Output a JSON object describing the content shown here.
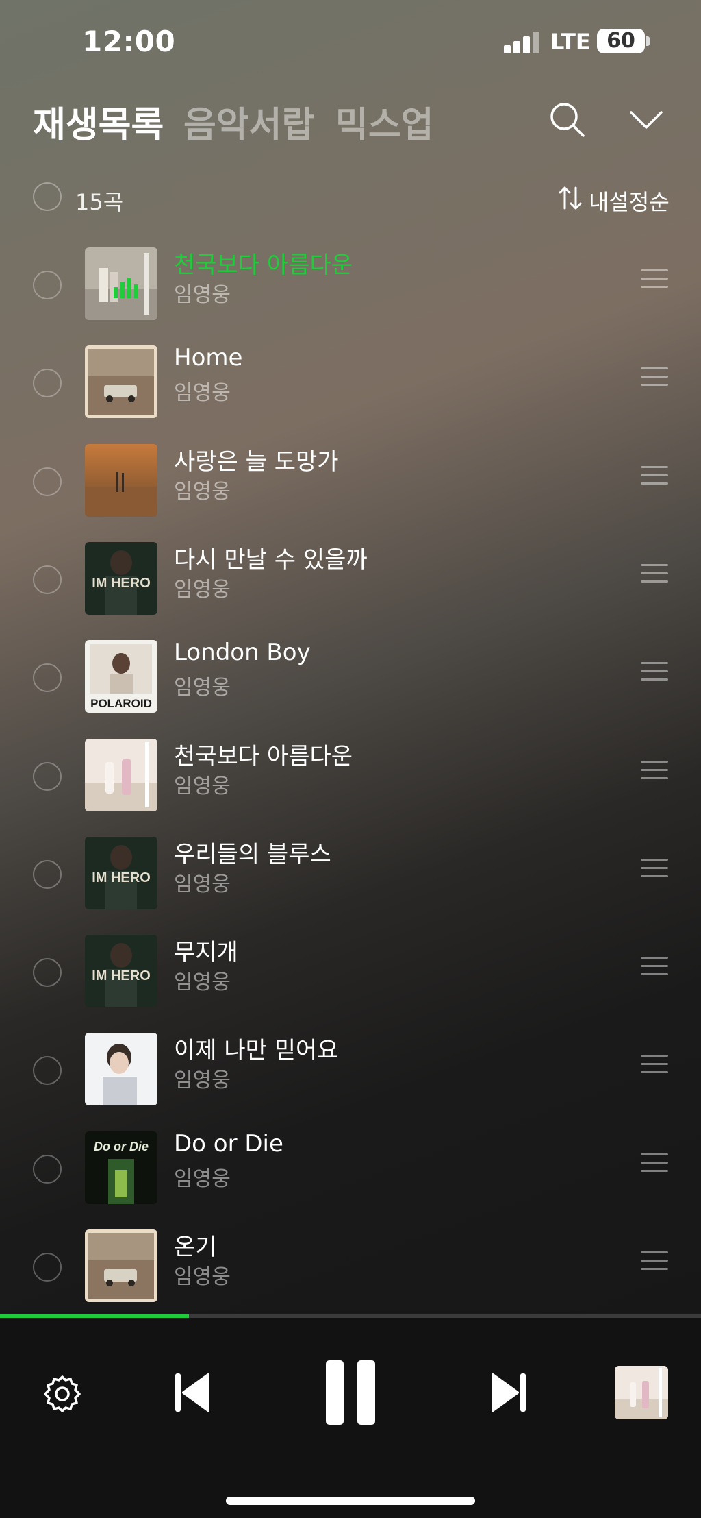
{
  "status_bar": {
    "time": "12:00",
    "network": "LTE",
    "battery": "60",
    "icons": [
      "signal-icon",
      "battery-icon"
    ]
  },
  "tabs": [
    {
      "label": "재생목록",
      "active": true
    },
    {
      "label": "음악서랍",
      "active": false
    },
    {
      "label": "믹스업",
      "active": false
    }
  ],
  "header_icons": [
    "search-icon",
    "chevron-down-icon"
  ],
  "list_header": {
    "count": "15곡",
    "sort_label": "내설정순",
    "sort_icon": "sort-arrows-icon"
  },
  "tracks": [
    {
      "title": "천국보다 아름다운",
      "artist": "임영웅",
      "playing": true
    },
    {
      "title": "Home",
      "artist": "임영웅",
      "playing": false
    },
    {
      "title": "사랑은 늘 도망가",
      "artist": "임영웅",
      "playing": false
    },
    {
      "title": "다시 만날 수 있을까",
      "artist": "임영웅",
      "playing": false
    },
    {
      "title": "London Boy",
      "artist": "임영웅",
      "playing": false
    },
    {
      "title": "천국보다 아름다운",
      "artist": "임영웅",
      "playing": false
    },
    {
      "title": "우리들의 블루스",
      "artist": "임영웅",
      "playing": false
    },
    {
      "title": "무지개",
      "artist": "임영웅",
      "playing": false
    },
    {
      "title": "이제 나만 믿어요",
      "artist": "임영웅",
      "playing": false
    },
    {
      "title": "Do or Die",
      "artist": "임영웅",
      "playing": false
    },
    {
      "title": "온기",
      "artist": "임영웅",
      "playing": false
    }
  ],
  "album_art_text": {
    "im_hero": "IM HERO",
    "polaroid": "POLAROID",
    "do_or_die": "Do or Die"
  },
  "playback": {
    "progress_fraction": 0.27
  },
  "player_controls": [
    "settings-gear-icon",
    "previous-track-icon",
    "pause-icon",
    "next-track-icon",
    "now-playing-thumbnail"
  ],
  "colors": {
    "accent": "#1fcc3a",
    "background_dark": "#121212"
  }
}
